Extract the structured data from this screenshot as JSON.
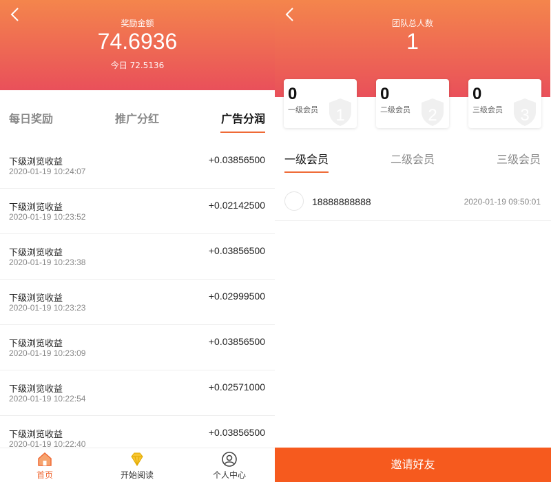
{
  "left": {
    "header": {
      "label": "奖励金额",
      "amount": "74.6936",
      "today": "今日 72.5136"
    },
    "tabs": [
      {
        "label": "每日奖励"
      },
      {
        "label": "推广分红"
      },
      {
        "label": "广告分润"
      }
    ],
    "active_tab": 2,
    "rows": [
      {
        "title": "下级浏览收益",
        "time": "2020-01-19 10:24:07",
        "amount": "+0.03856500"
      },
      {
        "title": "下级浏览收益",
        "time": "2020-01-19 10:23:52",
        "amount": "+0.02142500"
      },
      {
        "title": "下级浏览收益",
        "time": "2020-01-19 10:23:38",
        "amount": "+0.03856500"
      },
      {
        "title": "下级浏览收益",
        "time": "2020-01-19 10:23:23",
        "amount": "+0.02999500"
      },
      {
        "title": "下级浏览收益",
        "time": "2020-01-19 10:23:09",
        "amount": "+0.03856500"
      },
      {
        "title": "下级浏览收益",
        "time": "2020-01-19 10:22:54",
        "amount": "+0.02571000"
      },
      {
        "title": "下级浏览收益",
        "time": "2020-01-19 10:22:40",
        "amount": "+0.03856500"
      }
    ],
    "nav": [
      {
        "label": "首页",
        "icon": "home-icon"
      },
      {
        "label": "开始阅读",
        "icon": "diamond-icon"
      },
      {
        "label": "个人中心",
        "icon": "user-icon"
      }
    ]
  },
  "right": {
    "header": {
      "label": "团队总人数",
      "count": "1"
    },
    "cards": [
      {
        "num": "0",
        "label": "一级会员",
        "badge": "1"
      },
      {
        "num": "0",
        "label": "二级会员",
        "badge": "2"
      },
      {
        "num": "0",
        "label": "三级会员",
        "badge": "3"
      }
    ],
    "tabs": [
      {
        "label": "一级会员"
      },
      {
        "label": "二级会员"
      },
      {
        "label": "三级会员"
      }
    ],
    "member": {
      "phone": "18888888888",
      "time": "2020-01-19 09:50:01"
    },
    "invite_label": "邀请好友"
  },
  "colors": {
    "accent": "#ef6a36",
    "header_top": "#f4854c",
    "header_bottom": "#e9505a",
    "invite_bg": "#f65a1e"
  }
}
